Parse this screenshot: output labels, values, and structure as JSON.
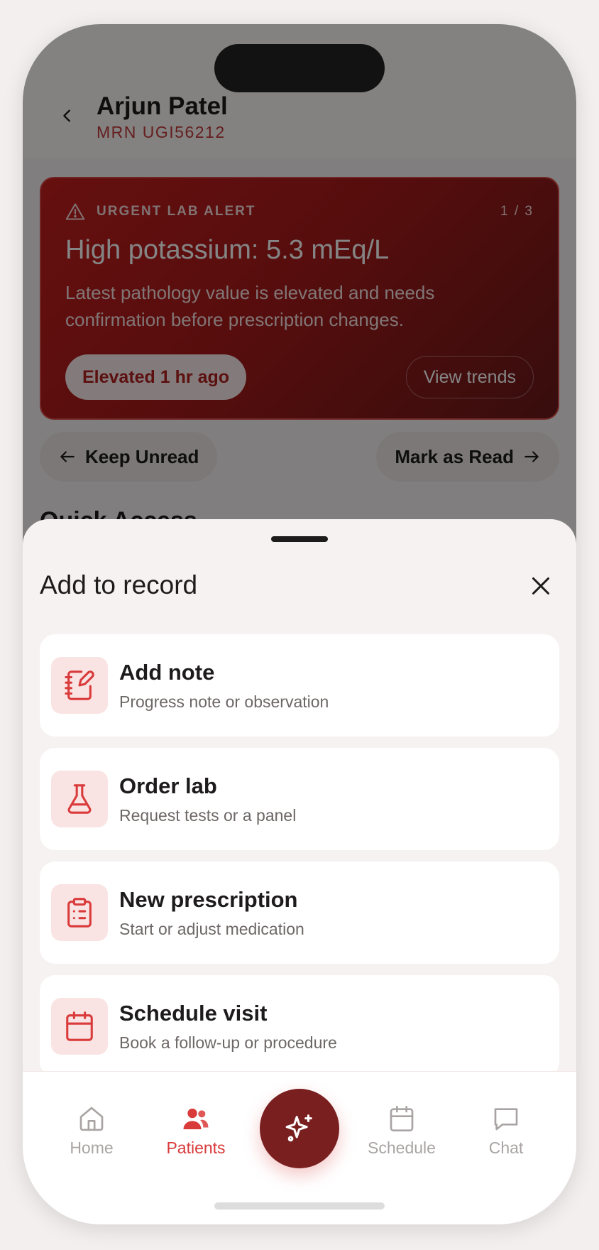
{
  "patient": {
    "name": "Arjun Patel",
    "mrn": "MRN UGI56212"
  },
  "alert": {
    "kicker": "URGENT LAB ALERT",
    "counter": "1 / 3",
    "title": "High potassium: 5.3 mEq/L",
    "description": "Latest pathology value is elevated and needs confirmation before prescription changes.",
    "status_pill": "Elevated 1 hr ago",
    "trends_button": "View trends"
  },
  "actions_row": {
    "keep_unread": "Keep Unread",
    "mark_read": "Mark as Read"
  },
  "section": {
    "quick_access": "Quick Access"
  },
  "sheet": {
    "title": "Add to record",
    "items": [
      {
        "title": "Add note",
        "subtitle": "Progress note or observation",
        "icon": "notebook-pen-icon"
      },
      {
        "title": "Order lab",
        "subtitle": "Request tests or a panel",
        "icon": "flask-icon"
      },
      {
        "title": "New prescription",
        "subtitle": "Start or adjust medication",
        "icon": "clipboard-list-icon"
      },
      {
        "title": "Schedule visit",
        "subtitle": "Book a follow-up or procedure",
        "icon": "calendar-icon"
      }
    ]
  },
  "tabbar": {
    "home": "Home",
    "patients": "Patients",
    "schedule": "Schedule",
    "chat": "Chat",
    "active": "patients"
  },
  "colors": {
    "accent": "#d93a3a",
    "fab": "#7a1f1f",
    "alert_red": "#c31e1e",
    "icon_bg": "#fae3e3"
  }
}
